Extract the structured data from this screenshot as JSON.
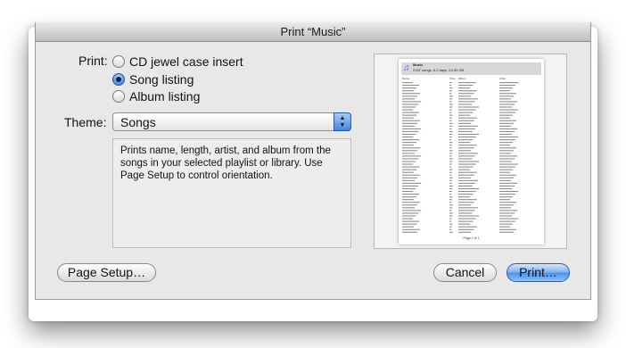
{
  "window": {
    "title": "Print “Music”"
  },
  "print_options": {
    "label": "Print:",
    "options": [
      {
        "label": "CD jewel case insert",
        "selected": false
      },
      {
        "label": "Song listing",
        "selected": true
      },
      {
        "label": "Album listing",
        "selected": false
      }
    ]
  },
  "theme": {
    "label": "Theme:",
    "selected": "Songs"
  },
  "description": "Prints name, length, artist, and album from the songs in your selected playlist or library. Use Page Setup to control orientation.",
  "preview": {
    "title": "Music",
    "subtitle": "2187 songs, 6.2 days, 24.39 GB",
    "columns": [
      "Name",
      "Time",
      "Album",
      "Artist"
    ],
    "footer": "Page 1 of 1"
  },
  "buttons": {
    "page_setup": "Page Setup…",
    "cancel": "Cancel",
    "print": "Print…"
  },
  "colors": {
    "default_button": "#4b92e8",
    "selected_radio": "#4a8fe0"
  }
}
